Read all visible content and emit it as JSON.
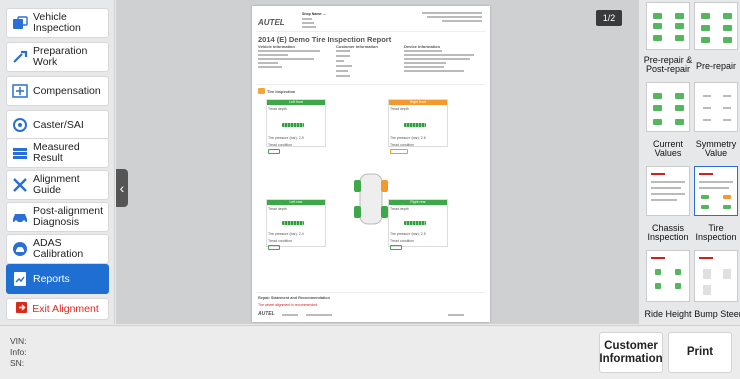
{
  "sidebar": {
    "items": [
      {
        "label": "Vehicle\nInspection"
      },
      {
        "label": "Preparation\nWork"
      },
      {
        "label": "Compensation"
      },
      {
        "label": "Caster/SAI"
      },
      {
        "label": "Measured\nResult"
      },
      {
        "label": "Alignment\nGuide"
      },
      {
        "label": "Post-alignment\nDiagnosis"
      },
      {
        "label": "ADAS\nCalibration"
      },
      {
        "label": "Reports"
      }
    ],
    "exit_label": "Exit Alignment"
  },
  "viewer": {
    "page_counter": "1/2",
    "report": {
      "brand": "AUTEL",
      "shop_name": "Shop Name: --",
      "title": "2014 (E) Demo Tire Inspection Report",
      "vehicle_info": "Vehicle Information",
      "customer_info": "Customer Information",
      "device_info": "Device Information",
      "section_tire": "Tire Inspection",
      "left_front": "Left front",
      "right_front": "Right front",
      "left_rear": "Left rear",
      "right_rear": "Right rear",
      "tread_depth": "Tread depth",
      "tire_pressure_lf": "Tire pressure (bar): 2.5",
      "tire_pressure_rf": "Tire pressure (bar): 2.6",
      "tire_pressure_lr": "Tire pressure (bar): 2.4",
      "tire_pressure_rr": "Tire pressure (bar): 2.5",
      "tread_condition": "Tread condition",
      "repair_heading": "Repair Statement and Recommendation",
      "repair_text": "The wheel alignment is recommended."
    }
  },
  "thumbnails": [
    {
      "label": "Pre-repair &\nPost-repair"
    },
    {
      "label": "Pre-repair"
    },
    {
      "label": "Current\nValues"
    },
    {
      "label": "Symmetry\nValue"
    },
    {
      "label": "Chassis\nInspection"
    },
    {
      "label": "Tire\nInspection"
    },
    {
      "label": "Ride Height"
    },
    {
      "label": "Bump Steer"
    }
  ],
  "vehicle": {
    "vin_label": "VIN:",
    "info_label": "Info:",
    "sn_label": "SN:"
  },
  "buttons": {
    "customer_info": "Customer\nInformation",
    "print": "Print"
  },
  "colors": {
    "accent": "#1e6fd1",
    "exit": "#d92a1e",
    "tire_ok": "#3ea74a",
    "tire_warn": "#f29a2e"
  }
}
